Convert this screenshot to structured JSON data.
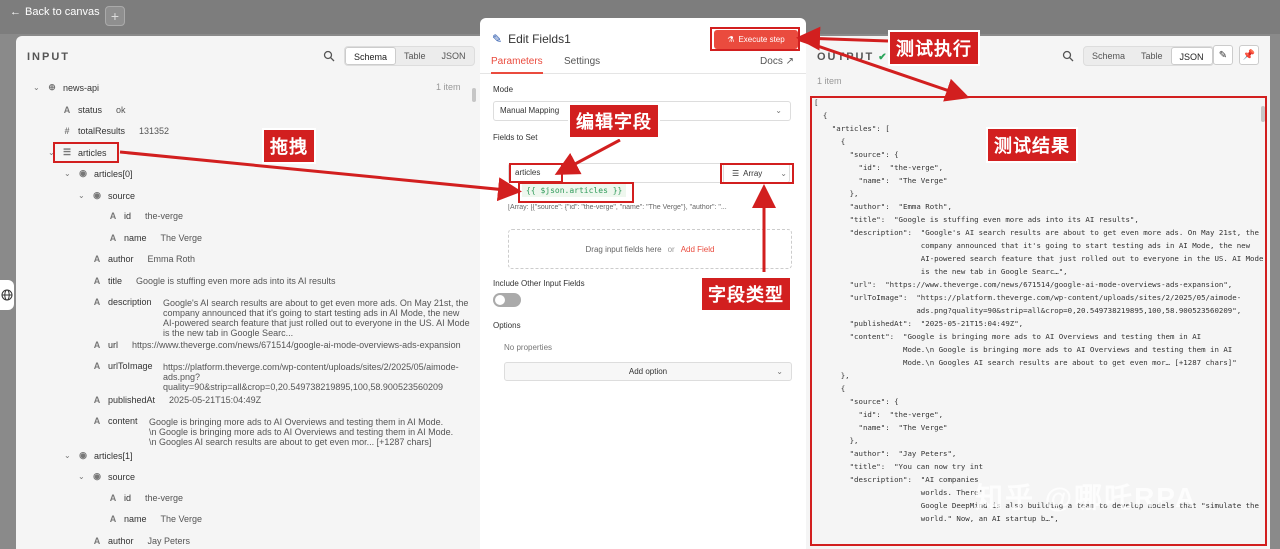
{
  "nav": {
    "back_label": "Back to canvas",
    "plus_label": "+"
  },
  "input": {
    "title": "INPUT",
    "view_tabs": [
      "Schema",
      "Table",
      "JSON"
    ],
    "item_count": "1 item",
    "root": "news-api",
    "rows": [
      {
        "key": "status",
        "value": "ok"
      },
      {
        "key": "totalResults",
        "value": "131352"
      },
      {
        "key": "articles"
      },
      {
        "key": "articles[0]"
      },
      {
        "key": "source"
      },
      {
        "key": "id",
        "value": "the-verge"
      },
      {
        "key": "name",
        "value": "The Verge"
      },
      {
        "key": "author",
        "value": "Emma Roth"
      },
      {
        "key": "title",
        "value": "Google is stuffing even more ads into its AI results"
      },
      {
        "key": "description"
      },
      {
        "key": "url",
        "value": "https://www.theverge.com/news/671514/google-ai-mode-overviews-ads-expansion"
      },
      {
        "key": "urlToImage"
      },
      {
        "key": "publishedAt",
        "value": "2025-05-21T15:04:49Z"
      },
      {
        "key": "content"
      },
      {
        "key": "articles[1]"
      },
      {
        "key": "source"
      },
      {
        "key": "id",
        "value": "the-verge"
      },
      {
        "key": "name",
        "value": "The Verge"
      },
      {
        "key": "author",
        "value": "Jay Peters"
      }
    ],
    "description_lines": [
      "Google's AI search results are about to get even more ads. On May 21st, the",
      "company announced that it's going to start testing ads in AI Mode, the new",
      "AI-powered search feature that just rolled out to everyone in the US. AI Mode",
      "is the new tab in Google Searc..."
    ],
    "urlToImage_lines": [
      "https://platform.theverge.com/wp-content/uploads/sites/2/2025/05/aimode-",
      "ads.png?",
      "quality=90&strip=all&crop=0,20.549738219895,100,58.900523560209"
    ],
    "content_lines": [
      "Google is bringing more ads to AI Overviews and testing them in AI Mode.",
      "\\n Google is bringing more ads to AI Overviews and testing them in AI Mode.",
      "\\n Googles AI search results are about to get even mor... [+1287 chars]"
    ]
  },
  "mid": {
    "title": "Edit Fields1",
    "execute_label": "Execute step",
    "tabs": [
      "Parameters",
      "Settings"
    ],
    "docs_label": "Docs",
    "mode_label": "Mode",
    "mode_value": "Manual Mapping",
    "fields_label": "Fields to Set",
    "field_name": "articles",
    "field_type": "Array",
    "expression": "{{ $json.articles }}",
    "preview": "[Array: [{\"source\": {\"id\": \"the-verge\", \"name\": \"The Verge\"}, \"author\": \"...",
    "drop_text": "Drag input fields here",
    "drop_or": "or",
    "add_field": "Add Field",
    "include_label": "Include Other Input Fields",
    "options_label": "Options",
    "no_props": "No properties",
    "add_option": "Add option"
  },
  "output": {
    "title": "OUTPUT",
    "view_tabs": [
      "Schema",
      "Table",
      "JSON"
    ],
    "item_count": "1 item",
    "json_lines": [
      "[",
      "  {",
      "    \"articles\": [",
      "      {",
      "        \"source\": {",
      "          \"id\":  \"the-verge\",",
      "          \"name\":  \"The Verge\"",
      "        },",
      "        \"author\":  \"Emma Roth\",",
      "        \"title\":  \"Google is stuffing even more ads into its AI results\",",
      "        \"description\":  \"Google's AI search results are about to get even more ads. On May 21st, the",
      "                        company announced that it's going to start testing ads in AI Mode, the new",
      "                        AI-powered search feature that just rolled out to everyone in the US. AI Mode",
      "                        is the new tab in Google Searc…\",",
      "        \"url\":  \"https://www.theverge.com/news/671514/google-ai-mode-overviews-ads-expansion\",",
      "        \"urlToImage\":  \"https://platform.theverge.com/wp-content/uploads/sites/2/2025/05/aimode-",
      "                       ads.png?quality=90&strip=all&crop=0,20.549738219895,100,58.900523560209\",",
      "        \"publishedAt\":  \"2025-05-21T15:04:49Z\",",
      "        \"content\":  \"Google is bringing more ads to AI Overviews and testing them in AI",
      "                    Mode.\\n Google is bringing more ads to AI Overviews and testing them in AI",
      "                    Mode.\\n Googles AI search results are about to get even mor… [+1287 chars]\"",
      "      },",
      "      {",
      "        \"source\": {",
      "          \"id\":  \"the-verge\",",
      "          \"name\":  \"The Verge\"",
      "        },",
      "        \"author\":  \"Jay Peters\",",
      "        \"title\":  \"You can now try int",
      "        \"description\":  \"AI companies",
      "                        worlds. There'",
      "                        Google DeepMind is also building a team to develop models that \"simulate the",
      "                        world.\" Now, an AI startup b…\","
    ]
  },
  "annotations": {
    "drag": "拖拽",
    "edit_field": "编辑字段",
    "test_exec": "测试执行",
    "test_result": "测试结果",
    "field_type": "字段类型"
  },
  "watermark": "知乎 @哪吒RPA",
  "colors": {
    "accent": "#ea4b3e",
    "annotation": "#d21f1f",
    "expression": "#2f9b5a"
  }
}
